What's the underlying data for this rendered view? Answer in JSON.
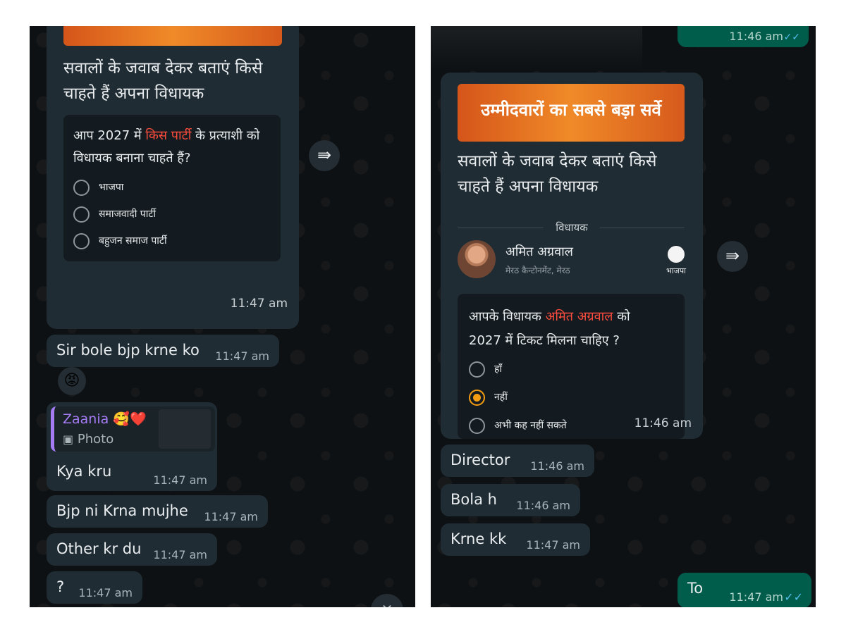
{
  "left": {
    "poll_card": {
      "title_line1": "सवालों के जवाब देकर बताएं किसे",
      "title_line2": "चाहते हैं अपना विधायक",
      "question_pre": "आप 2027 में ",
      "question_highlight": "किस पार्टी",
      "question_post": " के प्रत्याशी को",
      "question_line2": "विधायक बनाना चाहते हैं?",
      "options": [
        "भाजपा",
        "समाजवादी पार्टी",
        "बहुजन समाज पार्टी"
      ],
      "time": "11:47 am"
    },
    "messages": [
      {
        "text": "Sir bole bjp krne ko",
        "time": "11:47 am"
      },
      {
        "text": "Kya kru",
        "time": "11:47 am"
      },
      {
        "text": "Bjp ni Krna mujhe",
        "time": "11:47 am"
      },
      {
        "text": "Other kr du",
        "time": "11:47 am"
      },
      {
        "text": "?",
        "time": "11:47 am"
      }
    ],
    "reaction": "😡",
    "reply_quote": {
      "author": "Zaania 🥰❤️",
      "label": "Photo"
    }
  },
  "right": {
    "top_time": "11:46 am",
    "poll_card": {
      "banner": "उम्मीदवारों का सबसे बड़ा सर्वे",
      "title_line1": "सवालों के जवाब देकर बताएं किसे",
      "title_line2": "चाहते हैं अपना विधायक",
      "section_label": "विधायक",
      "candidate_name": "अमित अग्रवाल",
      "candidate_area": "मेरठ कैन्टोनमेंट, मेरठ",
      "party": "भाजपा",
      "question_pre": "आपके विधायक ",
      "question_highlight": "अमित अग्रवाल",
      "question_post": " को",
      "question_line2": "2027 में टिकट मिलना चाहिए ?",
      "options": [
        "हाँ",
        "नहीं",
        "अभी कह नहीं सकते"
      ],
      "selected_index": 1,
      "time": "11:46 am"
    },
    "messages": [
      {
        "text": "Director",
        "time": "11:46 am"
      },
      {
        "text": "Bola h",
        "time": "11:46 am"
      },
      {
        "text": "Krne kk",
        "time": "11:47 am"
      }
    ],
    "outgoing": {
      "text": "To",
      "time": "11:47 am",
      "ticks": "✓✓"
    }
  },
  "colors": {
    "bg": "#0e1113",
    "bubble_in": "#1f2c34",
    "bubble_out": "#005c4b",
    "accent": "#f39c12",
    "highlight": "#ff4d3d",
    "tick_blue": "#53bdeb"
  }
}
